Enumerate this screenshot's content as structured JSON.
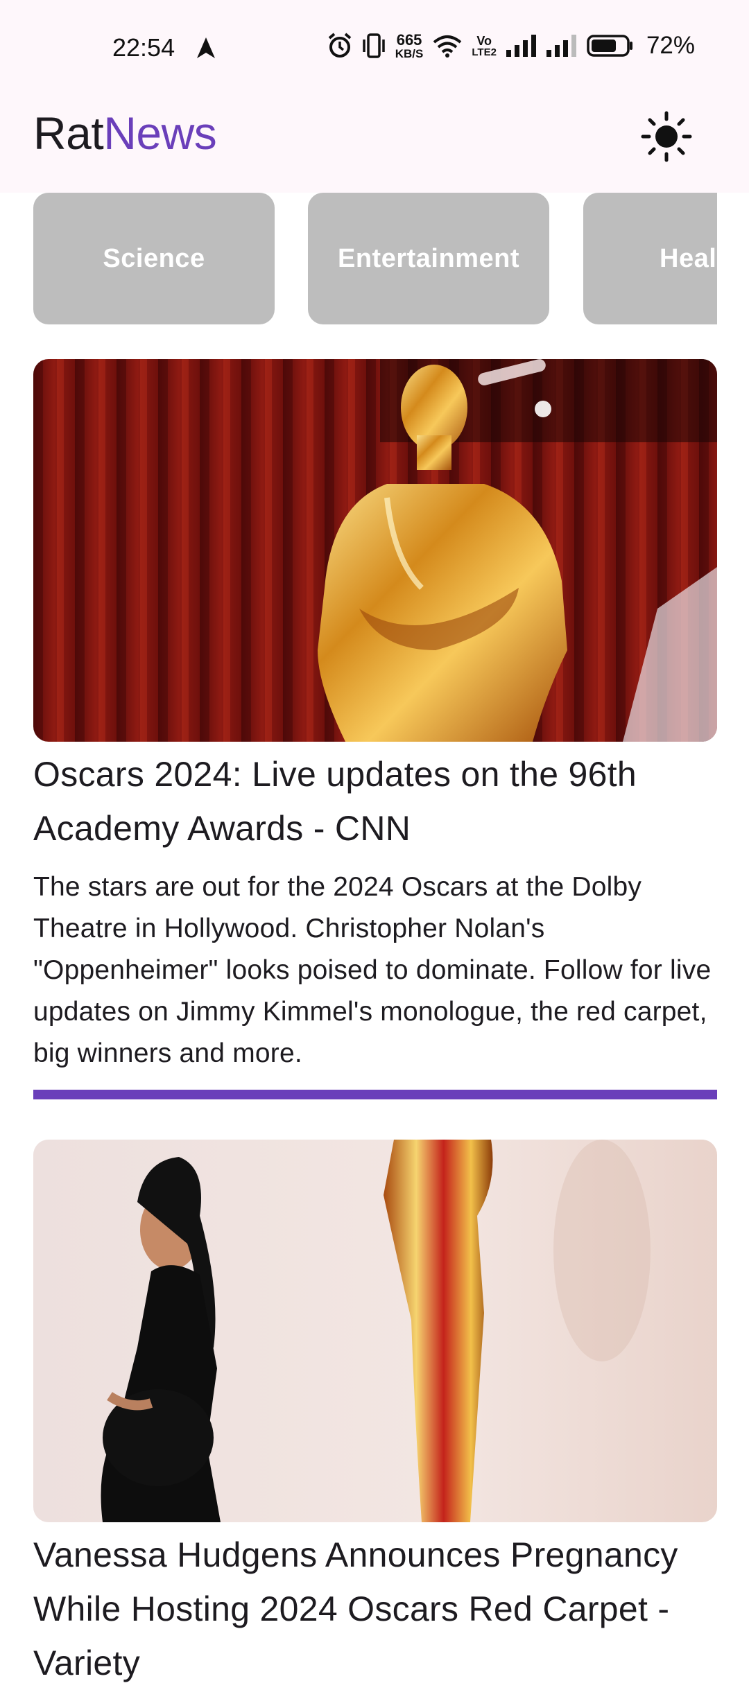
{
  "status_bar": {
    "time": "22:54",
    "network_speed_value": "665",
    "network_speed_unit": "KB/S",
    "volte_top": "Vo",
    "volte_bottom": "LTE2",
    "battery_percent": "72%",
    "battery_level": 0.72,
    "icons": [
      "navigation-arrow-icon",
      "alarm-icon",
      "vibrate-icon",
      "wifi-icon",
      "signal-icon",
      "signal-icon",
      "battery-icon"
    ]
  },
  "app_bar": {
    "brand_part1": "Rat",
    "brand_part2": "News",
    "theme_toggle_icon": "sun-icon"
  },
  "categories": [
    {
      "label": "Science"
    },
    {
      "label": "Entertainment"
    },
    {
      "label": "Heal"
    }
  ],
  "articles": [
    {
      "image_desc": "oscar-statue-red-curtain",
      "title": "Oscars 2024: Live updates on the 96th Academy Awards - CNN",
      "description": "The stars are out for the 2024 Oscars at the Dolby Theatre in Hollywood. Christopher Nolan's \"Oppenheimer\" looks poised to dominate. Follow for live updates on Jimmy Kimmel's monologue, the red carpet, big winners and more."
    },
    {
      "image_desc": "woman-black-dress-oscar-statue",
      "title": "Vanessa Hudgens Announces Pregnancy While Hosting 2024 Oscars Red Carpet - Variety"
    }
  ],
  "colors": {
    "accent": "#6a3fba",
    "chip_bg": "#bdbdbd",
    "appbar_bg": "#fef7fb"
  }
}
